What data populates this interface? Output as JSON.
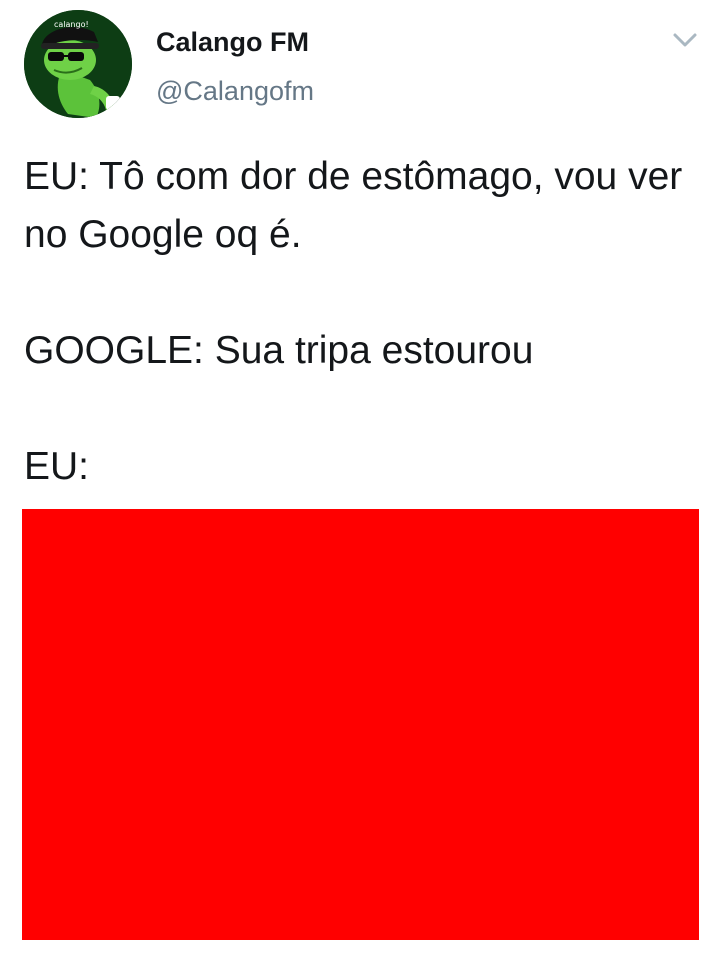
{
  "tweet": {
    "display_name": "Calango FM",
    "handle": "@Calangofm",
    "avatar": {
      "icon": "lizard-avatar-icon",
      "badge_text": "calango!"
    },
    "menu_icon": "chevron-down-icon",
    "text_lines": [
      "EU: Tô com dor de estômago, vou ver no Google oq é.",
      "GOOGLE: Sua tripa estourou",
      "EU:"
    ],
    "media": {
      "color": "#ff0000"
    }
  },
  "colors": {
    "name": "#14171a",
    "handle": "#657786",
    "chevron": "#aab8c2",
    "media": "#ff0000",
    "avatar_bg": "#0d3d14",
    "lizard": "#5cc23a"
  }
}
